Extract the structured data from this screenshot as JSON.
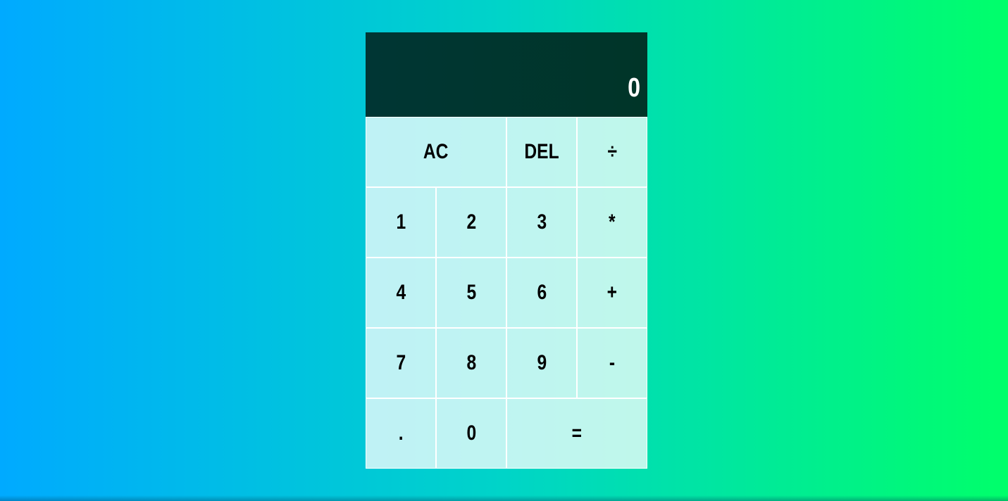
{
  "display": {
    "previous_operand": "",
    "current_operand": "0"
  },
  "keys": {
    "all_clear": "AC",
    "delete": "DEL",
    "divide": "÷",
    "one": "1",
    "two": "2",
    "three": "3",
    "multiply": "*",
    "four": "4",
    "five": "5",
    "six": "6",
    "add": "+",
    "seven": "7",
    "eight": "8",
    "nine": "9",
    "subtract": "-",
    "decimal": ".",
    "zero": "0",
    "equals": "="
  },
  "colors": {
    "background_start": "#00aaff",
    "background_end": "#00ff6a",
    "display_background": "#003634",
    "key_background": "#c0f2ee"
  }
}
